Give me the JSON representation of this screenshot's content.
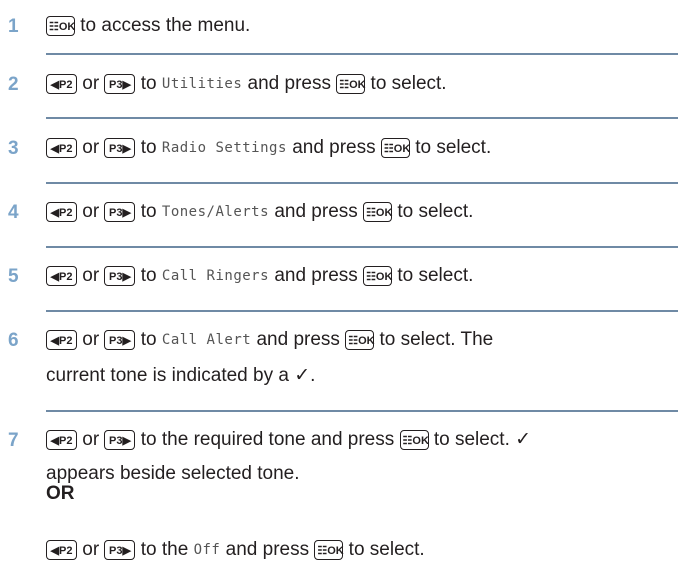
{
  "keys": {
    "menu": "☷OK",
    "p2": "◀P2",
    "p3": "P3▶"
  },
  "steps": [
    {
      "number": "1",
      "parts": [
        "to access the menu."
      ]
    },
    {
      "number": "2",
      "or": "or",
      "to": "to",
      "item": "Utilities",
      "press": "and press",
      "end": "to select."
    },
    {
      "number": "3",
      "or": "or",
      "to": "to",
      "item": "Radio Settings",
      "press": "and press",
      "end": "to select."
    },
    {
      "number": "4",
      "or": "or",
      "to": "to",
      "item": "Tones/Alerts",
      "press": "and press",
      "end": "to select."
    },
    {
      "number": "5",
      "or": "or",
      "to": "to",
      "item": "Call Ringers",
      "press": "and press",
      "end": "to select."
    },
    {
      "number": "6",
      "or": "or",
      "to": "to",
      "item": "Call Alert",
      "press": "and press",
      "end": "to select. The",
      "line2": "current tone is indicated by a ✓."
    },
    {
      "number": "7",
      "or": "or",
      "to": "to the required tone and press",
      "end": "to select. ✓",
      "line2": "appears beside selected tone.",
      "or_label": "OR",
      "alt_or": "or",
      "alt_to": "to the",
      "alt_item": "Off",
      "alt_press": "and press",
      "alt_end": "to select."
    }
  ]
}
